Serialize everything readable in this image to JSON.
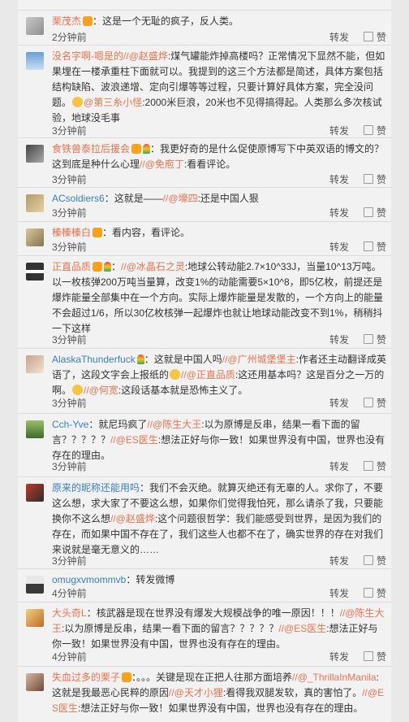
{
  "comments": [
    {
      "user": "栗茂杰",
      "text": "：这是一个无耻的疯子，反人类。",
      "time": "2分钟前"
    },
    {
      "user": "没名字啊-嗯是的",
      "mention1": "//@赵盛烨",
      "text": ":煤气罐能炸掉高楼吗？正常情况下显然不能，但如果埋在一楼承重柱下面就可以。我提到的这三个方法都是简述，具体方案包括结构缺陷、波浪递增、定向引爆等等过程，只要计算好具体方案，完全没问题。",
      "mention2": "@第三糸小怪",
      "text2": ":2000米巨浪，20米也不见得搞得起。人类那么多次核试验，地球没毛事",
      "time": "3分钟前"
    },
    {
      "user": "食铁兽泰拉后援会",
      "text": "：我更好奇的是什么促使原博写下中英双语的博文的？这到底是种什么心理",
      "mention": "//@免庖丁",
      "text2": ":看看评论。",
      "time": "3分钟前"
    },
    {
      "user": "ACsoldiers6",
      "text": "：这就是——",
      "mention": "//@壕四",
      "text2": ":还是中国人狠",
      "time": "3分钟前"
    },
    {
      "user": "榛榛榛白",
      "text": "：看内容，看评论。",
      "time": "3分钟前"
    },
    {
      "user": "正直品质",
      "mention": "//@冰晶石之灵",
      "text": ":地球公转动能2.7×10^33J，当量10^13万吨。以一枚核弹200万吨当量算，改变1%的动能需要5×10^8，即5亿枚，前提还是爆炸能量全部集中在一个方向。实际上爆炸能量是发散的，一个方向上的能量不会超过1/6，所以30亿枚核弹一起爆炸也就让地球动能改变不到1%，稍稍抖一下这样",
      "time": "3分钟前"
    },
    {
      "user": "AlaskaThunderfuck",
      "text": "：这就是中国人吗",
      "mention1": "//@广州城堡堡主",
      "text2": ":作者还主动翻译成英语了，这段文字会上报纸的",
      "mention2": "//@正直品质",
      "text3": ":这还用基本吗？这是百分之一万的啊。",
      "mention3": "//@何宽",
      "text4": ":这段话基本就是恐怖主义了。",
      "time": "3分钟前"
    },
    {
      "user": "Cch-Yve",
      "text": "：就尼玛疯了",
      "mention1": "//@陈生大王",
      "text2": ":以为原博是反串，结果一看下面的留言？？？？？",
      "mention2": "//@ES医生",
      "text3": ":想法正好与你一致！如果世界没有中国，世界也没有存在的理由。",
      "time": "3分钟前"
    },
    {
      "user": "原来的昵称还能用吗",
      "text": "：我们不会灭绝。就算灭绝还有无辜的人。求你了，不要这么想，求大家了不要这么想，如果你们觉得我怕死，那么请杀了我，只要能换你不这么想",
      "mention": "//@赵盛烨",
      "text2": ":这个问题很哲学：我们能感受到世界，是因为我们的存在，而如果中国不存在了，我们这些人也都不在了，确实世界的存在对我们来说就是毫无意义的……",
      "time": "3分钟前"
    },
    {
      "user": "omugxvmommvb",
      "text": "：转发微博",
      "time": "4分钟前"
    },
    {
      "user": "大头奇L",
      "text": "：核武器是现在世界没有爆发大规模战争的唯一原因！！！",
      "mention1": "//@陈生大王",
      "text2": ":以为原博是反串，结果一看下面的留言？？？？？",
      "mention2": "//@ES医生",
      "text3": ":想法正好与你一致！如果世界没有中国，世界也没有存在的理由。",
      "time": "4分钟前"
    },
    {
      "user": "失血过多的栗子",
      "text": "：。。。关键是现在正把人往那方面培养",
      "mention1": "//@_ThrillaInManila",
      "text2": ":这就是我最恶心民粹的原因",
      "mention2": "//@天才小狸",
      "text3": ":看得我双腿发软，真的害怕了。",
      "mention3": "//@ES医生",
      "text4": ":想法正好与你一致！如果世界没有中国，世界也没有存在的理由。",
      "time": ""
    }
  ],
  "actions": {
    "repost": "转发",
    "like": "赞"
  },
  "top_strip": {
    "repost": "转发",
    "like": "赞",
    "time": "2分钟前"
  }
}
